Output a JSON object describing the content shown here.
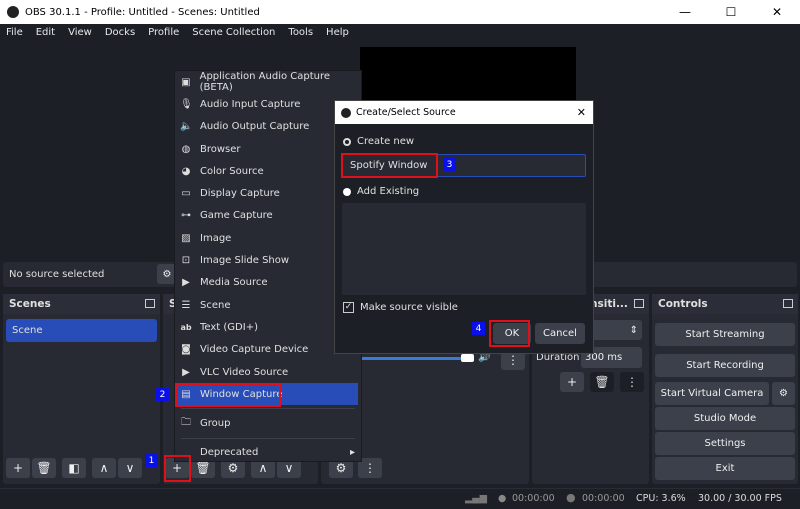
{
  "window": {
    "title": "OBS 30.1.1 - Profile: Untitled - Scenes: Untitled"
  },
  "menubar": [
    "File",
    "Edit",
    "View",
    "Docks",
    "Profile",
    "Scene Collection",
    "Tools",
    "Help"
  ],
  "source_bar": {
    "text": "No source selected"
  },
  "docks": {
    "scenes": "Scenes",
    "sources": "S",
    "transitions": "nsiti...",
    "controls": "Controls"
  },
  "scenes": [
    {
      "label": "Scene",
      "selected": true
    }
  ],
  "transitions": {
    "duration_label": "Duration",
    "duration_value": "300 ms"
  },
  "controls": [
    "Start Streaming",
    "Start Recording",
    "Start Virtual Camera",
    "Studio Mode",
    "Settings",
    "Exit"
  ],
  "context_menu": {
    "items": [
      {
        "label": "Application Audio Capture (BETA)",
        "icon": "app-audio-icon"
      },
      {
        "label": "Audio Input Capture",
        "icon": "microphone-icon"
      },
      {
        "label": "Audio Output Capture",
        "icon": "speaker-icon"
      },
      {
        "label": "Browser",
        "icon": "globe-icon"
      },
      {
        "label": "Color Source",
        "icon": "palette-icon"
      },
      {
        "label": "Display Capture",
        "icon": "monitor-icon"
      },
      {
        "label": "Game Capture",
        "icon": "gamepad-icon"
      },
      {
        "label": "Image",
        "icon": "image-icon"
      },
      {
        "label": "Image Slide Show",
        "icon": "slideshow-icon"
      },
      {
        "label": "Media Source",
        "icon": "play-icon"
      },
      {
        "label": "Scene",
        "icon": "list-icon"
      },
      {
        "label": "Text (GDI+)",
        "icon": "text-icon"
      },
      {
        "label": "Video Capture Device",
        "icon": "camera-icon"
      },
      {
        "label": "VLC Video Source",
        "icon": "play-icon"
      },
      {
        "label": "Window Capture",
        "icon": "window-icon",
        "selected": true
      }
    ],
    "group": "Group",
    "deprecated": "Deprecated"
  },
  "dialog": {
    "title": "Create/Select Source",
    "create_new": "Create new",
    "name_value": "Spotify Window",
    "add_existing": "Add Existing",
    "make_visible": "Make source visible",
    "make_visible_checked": true,
    "ok": "OK",
    "cancel": "Cancel"
  },
  "annotations": [
    "1",
    "2",
    "3",
    "4"
  ],
  "status": {
    "rec_time": "00:00:00",
    "stream_time": "00:00:00",
    "cpu": "CPU: 3.6%",
    "fps": "30.00 / 30.00 FPS"
  },
  "colors": {
    "accent": "#284cb8",
    "highlight": "#e0101a",
    "badge": "#0a10e8"
  }
}
